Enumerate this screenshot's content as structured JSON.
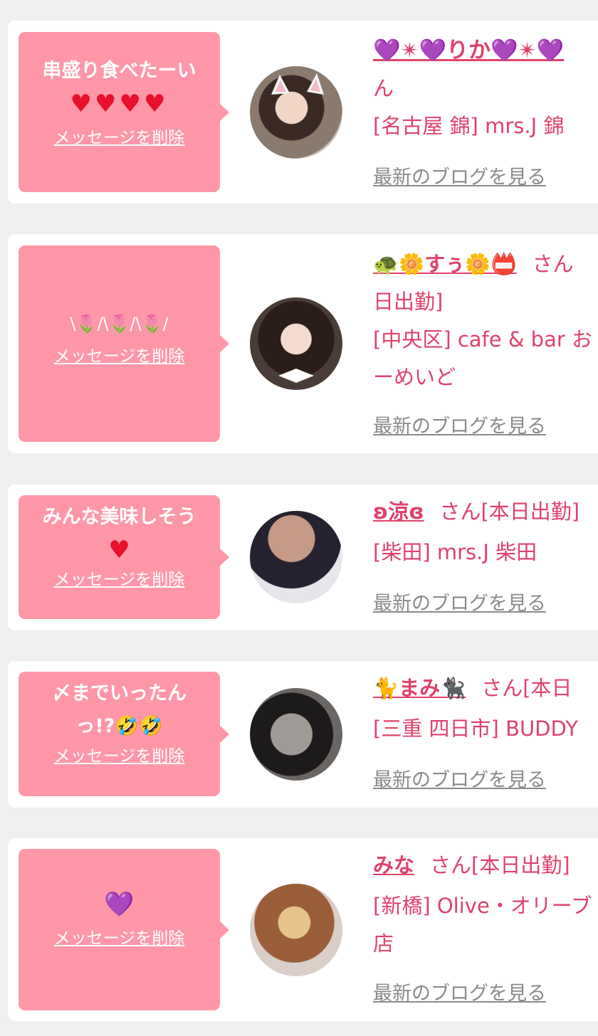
{
  "cards": [
    {
      "message_line1": "串盛り食べたーい",
      "message_line2": "♥♥♥♥",
      "delete_label": "メッセージを削除",
      "name": "💜✴💜りか💜✴💜",
      "line1_rest": "",
      "line2": "ん",
      "line3": "[名古屋 錦] mrs.J 錦",
      "line4": "",
      "blog_label": "最新のブログを見る"
    },
    {
      "message_line1": "",
      "message_line2": "\\🌷/\\🌷/\\🌷/",
      "delete_label": "メッセージを削除",
      "name": "🐢🌼すぅ🌼📛",
      "line1_rest": "さん",
      "line2": "日出勤]",
      "line3": "[中央区] cafe & bar お",
      "line4": "ーめいど",
      "blog_label": "最新のブログを見る"
    },
    {
      "message_line1": "みんな美味しそう",
      "message_line2": "♥",
      "delete_label": "メッセージを削除",
      "name": "ʚ涼ɞ",
      "line1_rest": "さん[本日出勤]",
      "line2": "[柴田] mrs.J 柴田",
      "line3": "",
      "line4": "",
      "blog_label": "最新のブログを見る"
    },
    {
      "message_line1": "〆までいったん",
      "message_line2": "っ!?🤣🤣",
      "delete_label": "メッセージを削除",
      "name": "🐈まみ🐈‍⬛",
      "line1_rest": "さん[本日",
      "line2": "[三重 四日市] BUDDY",
      "line3": "",
      "line4": "",
      "blog_label": "最新のブログを見る"
    },
    {
      "message_line1": "",
      "message_line2": "💜",
      "delete_label": "メッセージを削除",
      "name": "みな",
      "line1_rest": "さん[本日出勤]",
      "line2": "[新橋] Olive・オリーブ",
      "line3": "店",
      "line4": "",
      "blog_label": "最新のブログを見る"
    }
  ],
  "colors": {
    "background": "#efefef",
    "card": "#ffffff",
    "bubble": "#ff97a8",
    "accent_text": "#e0426a",
    "link_gray": "#8a8a8a",
    "heart_red": "#e8102a"
  },
  "icons": [
    "heart-icon",
    "tulip-icon",
    "purple-heart-icon",
    "laughing-emoji-icon",
    "cat-icon"
  ]
}
